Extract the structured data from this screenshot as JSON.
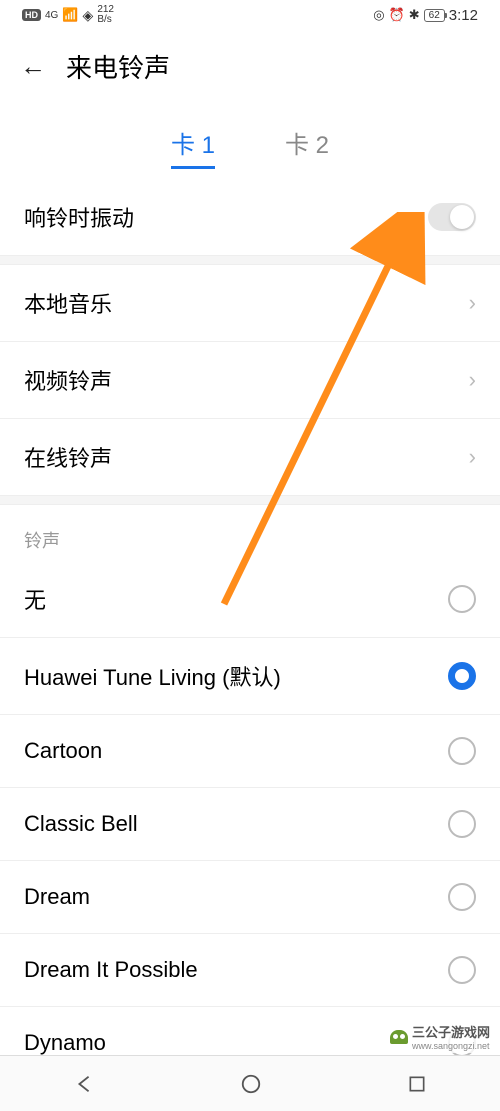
{
  "status": {
    "hd": "HD",
    "signal": "4G",
    "speed_top": "212",
    "speed_bottom": "B/s",
    "battery": "62",
    "time": "3:12"
  },
  "header": {
    "title": "来电铃声"
  },
  "tabs": {
    "tab1": "卡 1",
    "tab2": "卡 2"
  },
  "vibrate": {
    "label": "响铃时振动"
  },
  "links": {
    "local": "本地音乐",
    "video": "视频铃声",
    "online": "在线铃声"
  },
  "section": {
    "label": "铃声"
  },
  "ringtones": {
    "none": "无",
    "default": "Huawei Tune Living (默认)",
    "cartoon": "Cartoon",
    "classic": "Classic Bell",
    "dream": "Dream",
    "dreamit": "Dream It Possible",
    "dynamo": "Dynamo"
  },
  "watermark": {
    "text": "三公子游戏网",
    "url": "www.sangongzi.net"
  }
}
